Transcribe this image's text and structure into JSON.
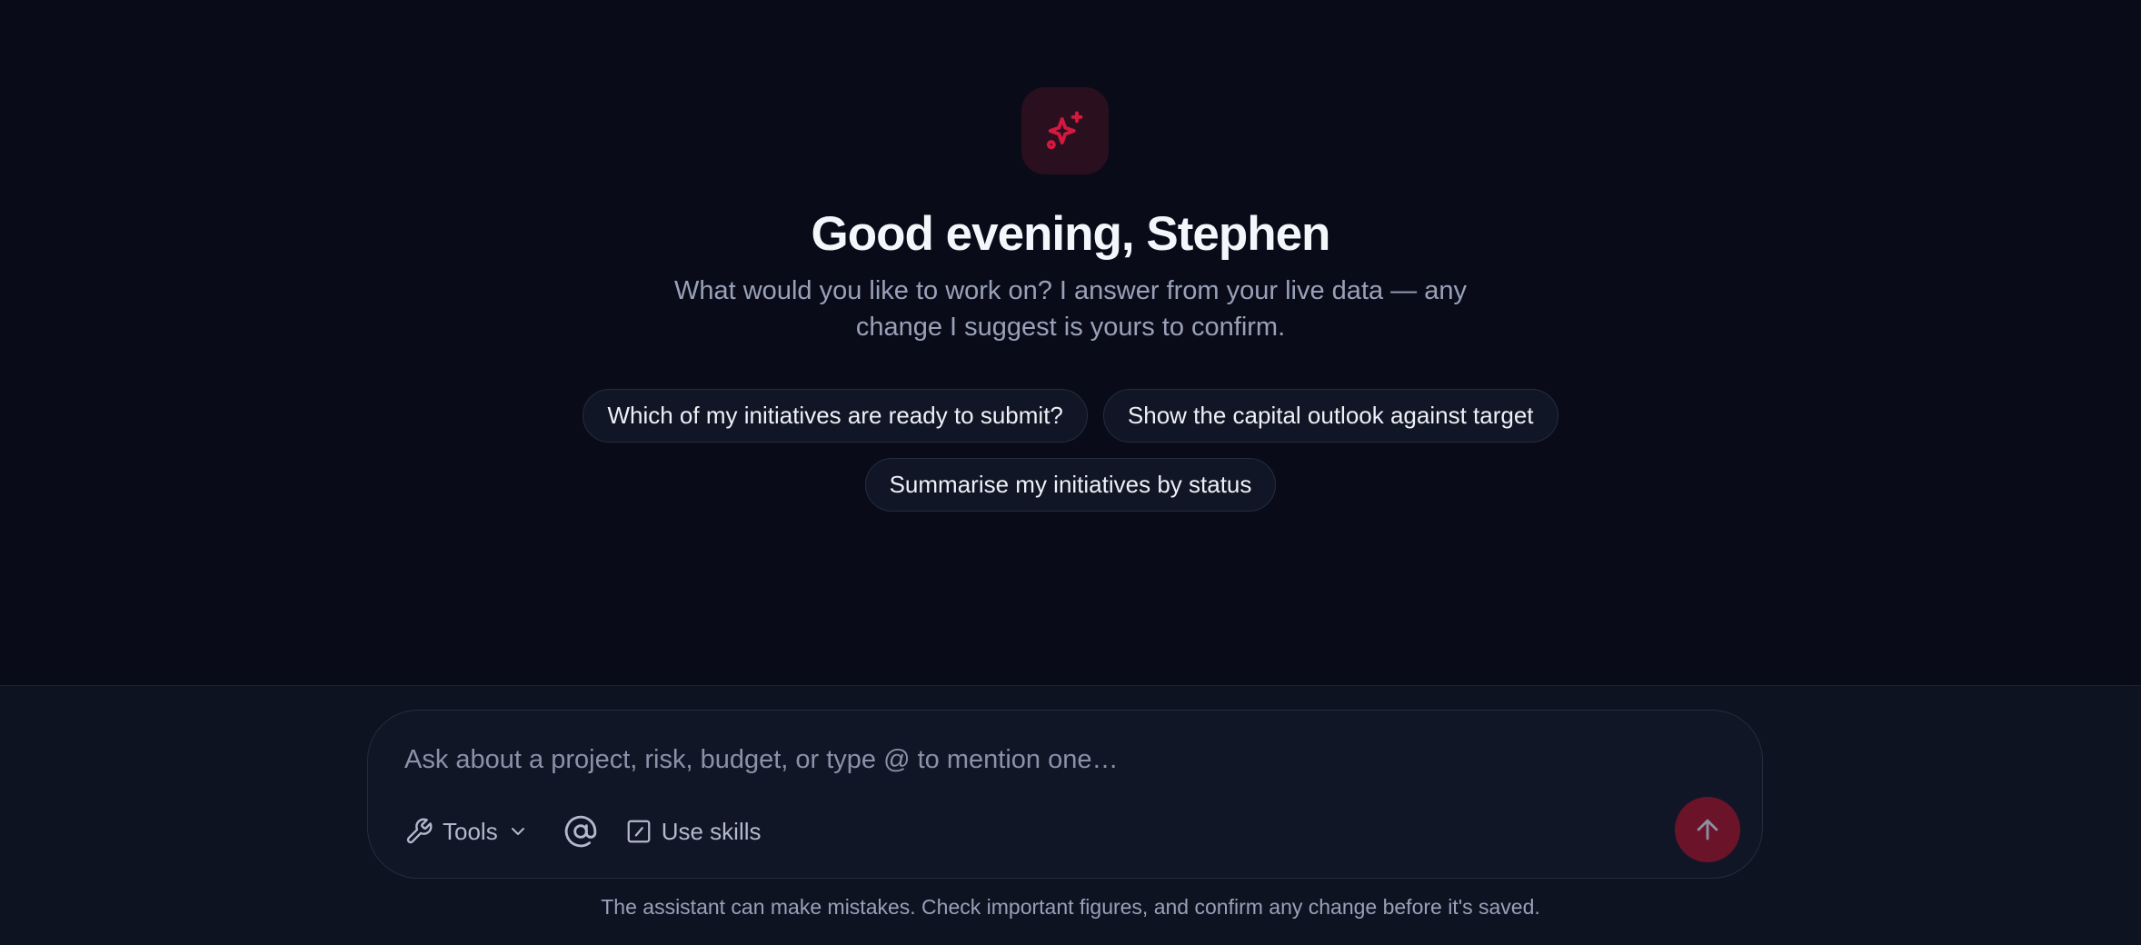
{
  "hero": {
    "icon": "sparkles-icon",
    "accent_color": "#d5183f",
    "greeting": "Good evening, Stephen",
    "subtitle": "What would you like to work on? I answer from your live data — any change I suggest is yours to confirm."
  },
  "suggestions": [
    "Which of my initiatives are ready to submit?",
    "Show the capital outlook against target",
    "Summarise my initiatives by status"
  ],
  "composer": {
    "placeholder": "Ask about a project, risk, budget, or type @ to mention one…",
    "value": "",
    "tools_label": "Tools",
    "mention_icon": "at-icon",
    "skills_label": "Use skills",
    "send_icon": "arrow-up-icon"
  },
  "footer": {
    "disclaimer": "The assistant can make mistakes. Check important figures, and confirm any change before it's saved."
  }
}
